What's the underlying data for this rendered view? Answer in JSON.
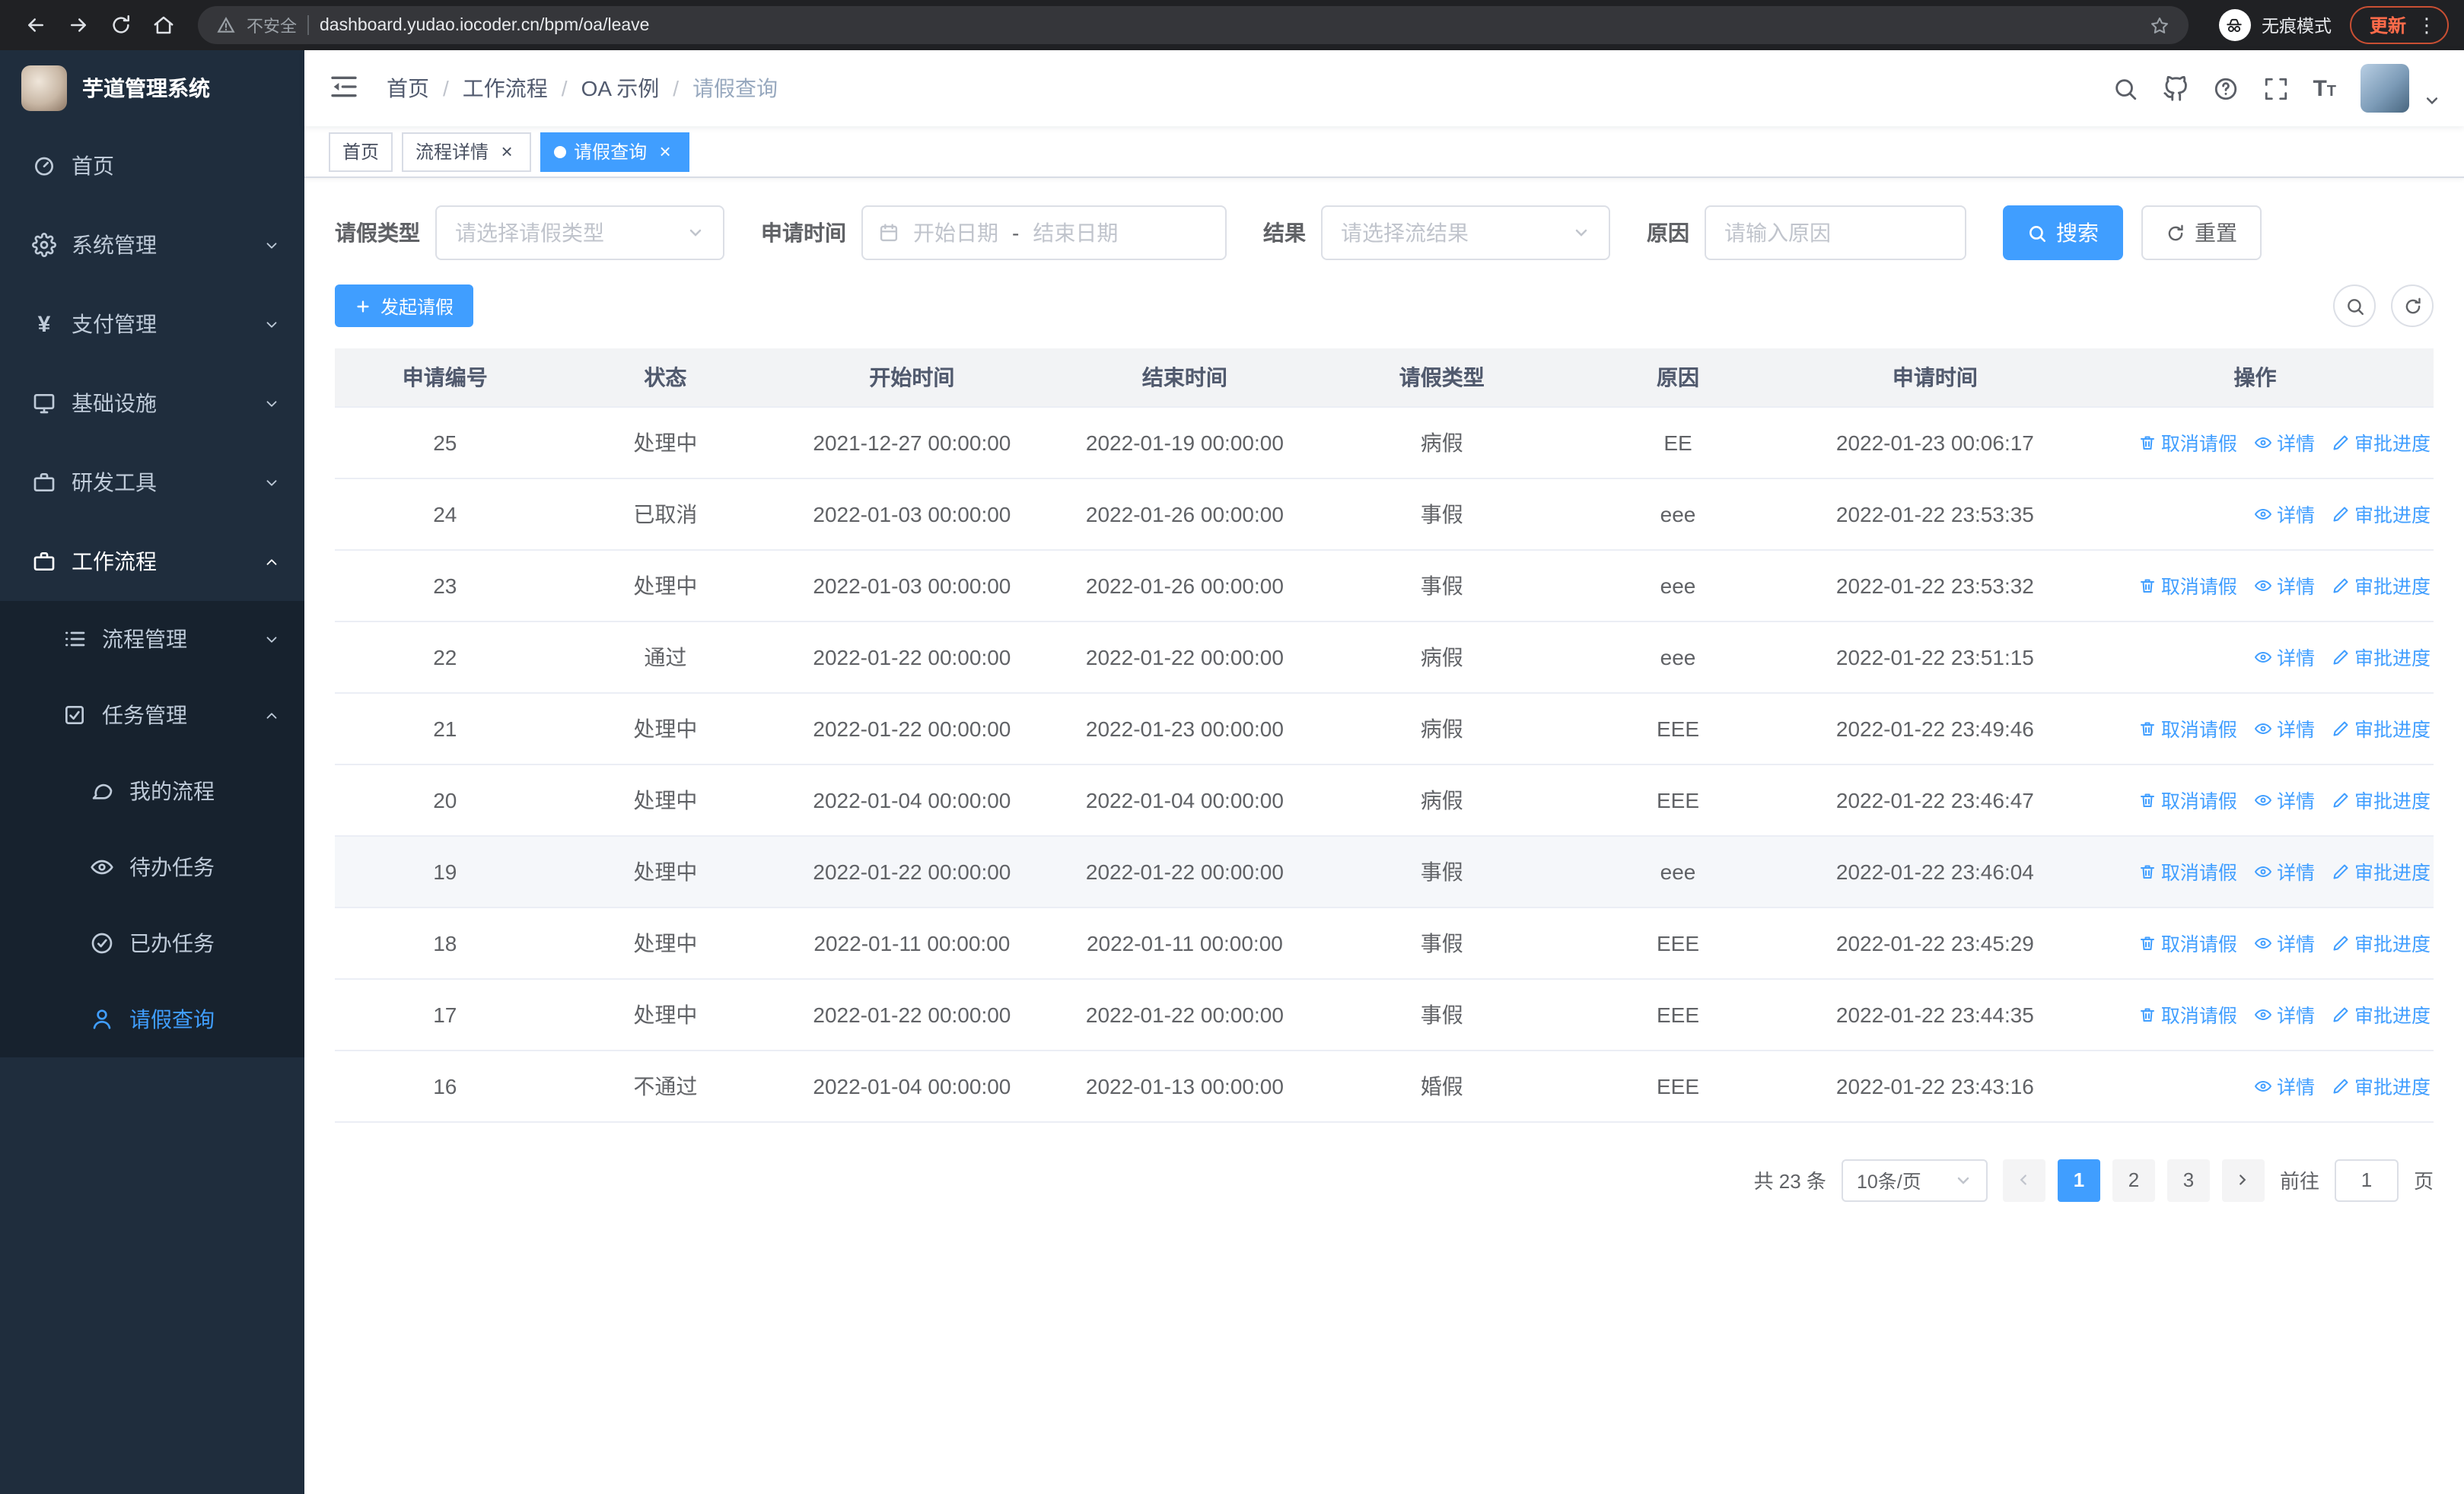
{
  "browser": {
    "nav_icons": [
      "back",
      "forward",
      "reload",
      "home"
    ],
    "security_label": "不安全",
    "url": "dashboard.yudao.iocoder.cn/bpm/oa/leave",
    "incognito_label": "无痕模式",
    "update_label": "更新"
  },
  "sidebar": {
    "app_title": "芋道管理系统",
    "menu": [
      {
        "name": "home",
        "label": "首页",
        "icon": "dashboard",
        "level": 1
      },
      {
        "name": "system-management",
        "label": "系统管理",
        "icon": "gear",
        "level": 1,
        "arrow": "down"
      },
      {
        "name": "payment-management",
        "label": "支付管理",
        "icon": "yen",
        "level": 1,
        "arrow": "down"
      },
      {
        "name": "infrastructure",
        "label": "基础设施",
        "icon": "monitor",
        "level": 1,
        "arrow": "down"
      },
      {
        "name": "dev-tools",
        "label": "研发工具",
        "icon": "briefcase",
        "level": 1,
        "arrow": "down"
      },
      {
        "name": "workflow",
        "label": "工作流程",
        "icon": "briefcase",
        "level": 1,
        "arrow": "up",
        "highlight": true
      },
      {
        "name": "process-management",
        "label": "流程管理",
        "icon": "list",
        "level": 2,
        "arrow": "down"
      },
      {
        "name": "task-management",
        "label": "任务管理",
        "icon": "tasks",
        "level": 2,
        "arrow": "up"
      },
      {
        "name": "my-processes",
        "label": "我的流程",
        "icon": "chat",
        "level": 3
      },
      {
        "name": "todo-tasks",
        "label": "待办任务",
        "icon": "eye",
        "level": 3
      },
      {
        "name": "done-tasks",
        "label": "已办任务",
        "icon": "check-circle",
        "level": 3
      },
      {
        "name": "leave-query",
        "label": "请假查询",
        "icon": "user",
        "level": 3,
        "active": true
      }
    ]
  },
  "header": {
    "breadcrumb": [
      "首页",
      "工作流程",
      "OA 示例",
      "请假查询"
    ],
    "action_icons": [
      "search",
      "github",
      "help",
      "fullscreen",
      "font-size"
    ]
  },
  "tabs": [
    {
      "label": "首页",
      "closable": false,
      "active": false
    },
    {
      "label": "流程详情",
      "closable": true,
      "active": false
    },
    {
      "label": "请假查询",
      "closable": true,
      "active": true
    }
  ],
  "filters": {
    "leave_type_label": "请假类型",
    "leave_type_placeholder": "请选择请假类型",
    "apply_time_label": "申请时间",
    "start_date_placeholder": "开始日期",
    "range_separator": "-",
    "end_date_placeholder": "结束日期",
    "result_label": "结果",
    "result_placeholder": "请选择流结果",
    "reason_label": "原因",
    "reason_placeholder": "请输入原因",
    "search_label": "搜索",
    "reset_label": "重置"
  },
  "toolbar": {
    "create_label": "发起请假"
  },
  "table": {
    "columns": [
      "申请编号",
      "状态",
      "开始时间",
      "结束时间",
      "请假类型",
      "原因",
      "申请时间",
      "操作"
    ],
    "actions": {
      "cancel": {
        "label": "取消请假",
        "icon": "trash"
      },
      "detail": {
        "label": "详情",
        "icon": "eye"
      },
      "progress": {
        "label": "审批进度",
        "icon": "edit"
      }
    },
    "rows": [
      {
        "id": "25",
        "status": "处理中",
        "start": "2021-12-27 00:00:00",
        "end": "2022-01-19 00:00:00",
        "type": "病假",
        "reason": "EE",
        "apply_time": "2022-01-23 00:06:17",
        "cancellable": true
      },
      {
        "id": "24",
        "status": "已取消",
        "start": "2022-01-03 00:00:00",
        "end": "2022-01-26 00:00:00",
        "type": "事假",
        "reason": "eee",
        "apply_time": "2022-01-22 23:53:35",
        "cancellable": false
      },
      {
        "id": "23",
        "status": "处理中",
        "start": "2022-01-03 00:00:00",
        "end": "2022-01-26 00:00:00",
        "type": "事假",
        "reason": "eee",
        "apply_time": "2022-01-22 23:53:32",
        "cancellable": true
      },
      {
        "id": "22",
        "status": "通过",
        "start": "2022-01-22 00:00:00",
        "end": "2022-01-22 00:00:00",
        "type": "病假",
        "reason": "eee",
        "apply_time": "2022-01-22 23:51:15",
        "cancellable": false
      },
      {
        "id": "21",
        "status": "处理中",
        "start": "2022-01-22 00:00:00",
        "end": "2022-01-23 00:00:00",
        "type": "病假",
        "reason": "EEE",
        "apply_time": "2022-01-22 23:49:46",
        "cancellable": true
      },
      {
        "id": "20",
        "status": "处理中",
        "start": "2022-01-04 00:00:00",
        "end": "2022-01-04 00:00:00",
        "type": "病假",
        "reason": "EEE",
        "apply_time": "2022-01-22 23:46:47",
        "cancellable": true
      },
      {
        "id": "19",
        "status": "处理中",
        "start": "2022-01-22 00:00:00",
        "end": "2022-01-22 00:00:00",
        "type": "事假",
        "reason": "eee",
        "apply_time": "2022-01-22 23:46:04",
        "cancellable": true,
        "highlighted": true
      },
      {
        "id": "18",
        "status": "处理中",
        "start": "2022-01-11 00:00:00",
        "end": "2022-01-11 00:00:00",
        "type": "事假",
        "reason": "EEE",
        "apply_time": "2022-01-22 23:45:29",
        "cancellable": true
      },
      {
        "id": "17",
        "status": "处理中",
        "start": "2022-01-22 00:00:00",
        "end": "2022-01-22 00:00:00",
        "type": "事假",
        "reason": "EEE",
        "apply_time": "2022-01-22 23:44:35",
        "cancellable": true
      },
      {
        "id": "16",
        "status": "不通过",
        "start": "2022-01-04 00:00:00",
        "end": "2022-01-13 00:00:00",
        "type": "婚假",
        "reason": "EEE",
        "apply_time": "2022-01-22 23:43:16",
        "cancellable": false
      }
    ]
  },
  "pagination": {
    "total_text": "共 23 条",
    "page_size_label": "10条/页",
    "pages": [
      "1",
      "2",
      "3"
    ],
    "active_page": "1",
    "goto_label": "前往",
    "goto_value": "1",
    "goto_suffix": "页"
  },
  "colors": {
    "primary": "#409eff",
    "sidebar_bg": "#1f2d3d",
    "chrome_bg": "#202124"
  }
}
